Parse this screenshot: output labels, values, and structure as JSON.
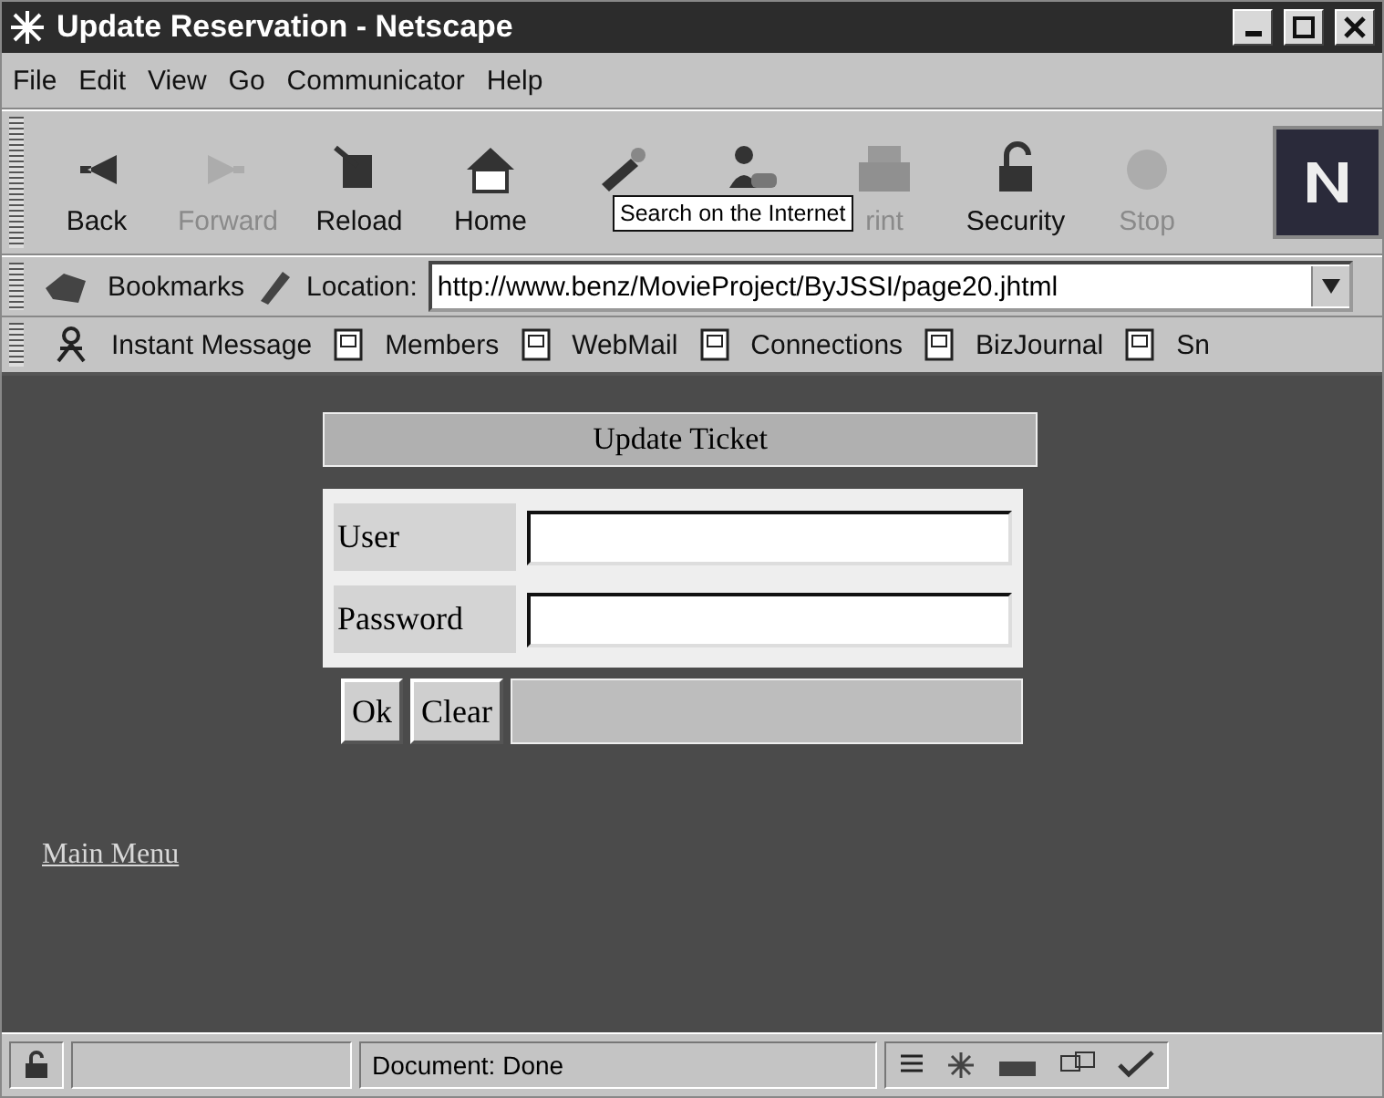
{
  "window": {
    "title": "Update Reservation - Netscape"
  },
  "menu": [
    "File",
    "Edit",
    "View",
    "Go",
    "Communicator",
    "Help"
  ],
  "toolbar": [
    {
      "label": "Back",
      "disabled": false
    },
    {
      "label": "Forward",
      "disabled": true
    },
    {
      "label": "Reload",
      "disabled": false
    },
    {
      "label": "Home",
      "disabled": false
    },
    {
      "disabled": false
    },
    {
      "disabled": false
    },
    {
      "label": "rint",
      "disabled": true
    },
    {
      "label": "Security",
      "disabled": false
    },
    {
      "label": "Stop",
      "disabled": true
    }
  ],
  "tooltip": "Search on the Internet",
  "location_bar": {
    "bookmarks": "Bookmarks",
    "label": "Location:",
    "url": "http://www.benz/MovieProject/ByJSSI/page20.jhtml"
  },
  "personal_toolbar": [
    "Instant Message",
    "Members",
    "WebMail",
    "Connections",
    "BizJournal",
    "Sn"
  ],
  "form": {
    "title": "Update Ticket",
    "fields": [
      {
        "label": "User"
      },
      {
        "label": "Password"
      }
    ],
    "buttons": [
      "Ok",
      "Clear"
    ]
  },
  "link": "Main Menu",
  "status_bar": {
    "text": "Document: Done"
  }
}
